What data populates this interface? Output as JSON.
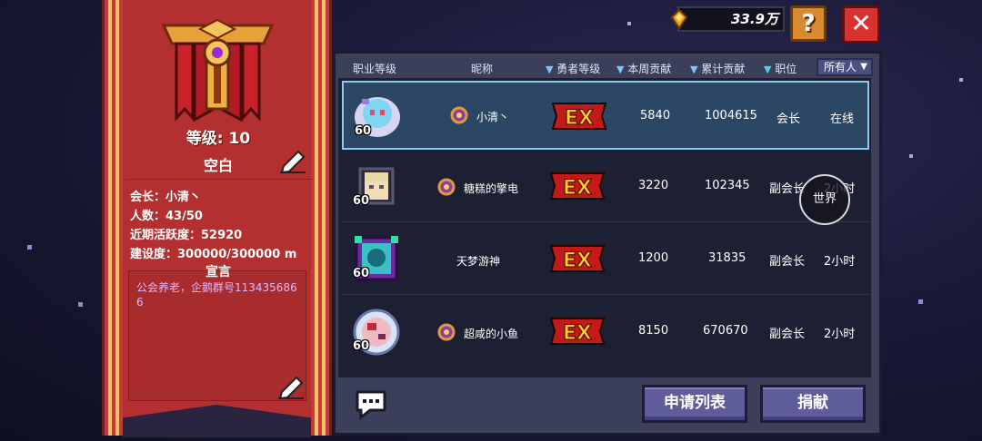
{
  "guild": {
    "level_text": "等级: 10",
    "name": "空白",
    "leader": "会长：小清丶",
    "members": "人数：43/50",
    "activity": "近期活跃度：52920",
    "construction": "建设度：300000/300000 m",
    "notice_title": "宣言",
    "notice_text": "公会养老，企鹅群号1134356866"
  },
  "currency": {
    "value": "33.9万",
    "icon": "gold-gem-icon"
  },
  "buttons": {
    "help": "?",
    "close": "✕",
    "world": "世界",
    "apply_list": "申请列表",
    "donate": "捐献"
  },
  "table": {
    "headers": {
      "class_level": "职业等级",
      "nickname": "昵称",
      "hero_level": "勇者等级",
      "weekly": "本周贡献",
      "total": "累计贡献",
      "position": "职位"
    },
    "filter": "所有人",
    "rank_badge": "EX",
    "rows": [
      {
        "level": "60",
        "name": "小清丶",
        "weekly": "5840",
        "total": "1004615",
        "position": "会长",
        "status": "在线",
        "has_rank_icon": true
      },
      {
        "level": "60",
        "name": "糖糕的擎电",
        "weekly": "3220",
        "total": "102345",
        "position": "副会长",
        "status": "2小时",
        "has_rank_icon": true
      },
      {
        "level": "60",
        "name": "天梦游神",
        "weekly": "1200",
        "total": "31835",
        "position": "副会长",
        "status": "2小时",
        "has_rank_icon": false
      },
      {
        "level": "60",
        "name": "超咸的小鱼",
        "weekly": "8150",
        "total": "670670",
        "position": "副会长",
        "status": "2小时",
        "has_rank_icon": true
      }
    ]
  },
  "colors": {
    "banner": "#c23a3a",
    "panel": "#3b3f5a",
    "selected_row": "#2b4763",
    "button": "#5f5c9c"
  }
}
